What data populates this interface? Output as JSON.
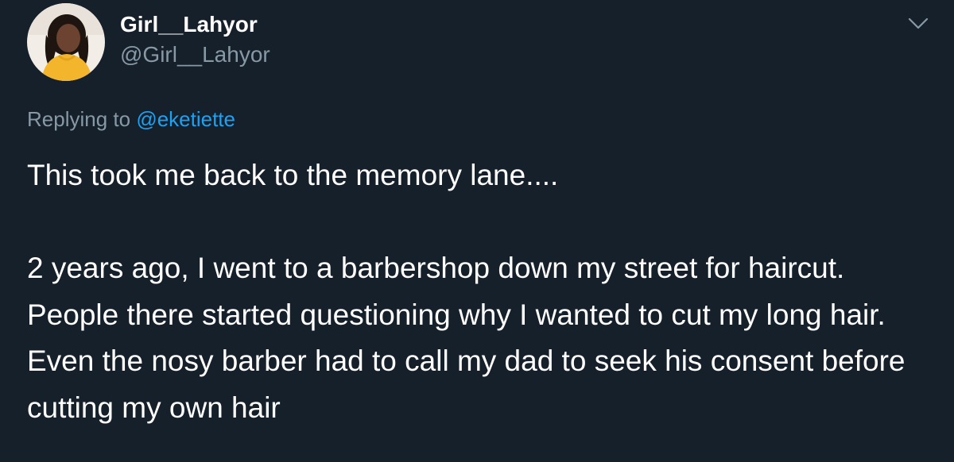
{
  "tweet": {
    "author": {
      "display_name": "Girl__Lahyor",
      "handle": "@Girl__Lahyor",
      "avatar": "profile-photo"
    },
    "menu_icon": "chevron-down-icon",
    "reply": {
      "prefix": "Replying to",
      "mention": "@eketiette"
    },
    "paragraphs": [
      "This took me back to the memory lane....",
      "2 years ago, I went to a barbershop down my street for haircut. People there started questioning why I wanted to cut my long hair. Even the nosy barber had to call my dad to seek his consent before cutting my own hair"
    ]
  },
  "colors": {
    "background": "#15202b",
    "primary_text": "#ffffff",
    "secondary_text": "#8899a6",
    "link": "#1da1f2"
  }
}
